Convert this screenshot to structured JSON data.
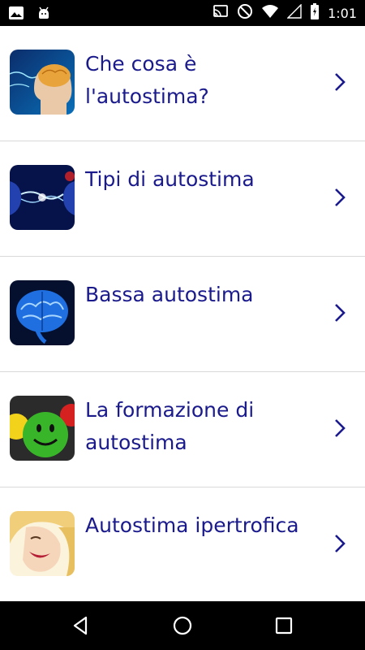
{
  "status_bar": {
    "time": "1:01",
    "left_icons": [
      "image-icon",
      "android-debug-icon"
    ],
    "right_icons": [
      "cast-icon",
      "do-not-disturb-icon",
      "wifi-icon",
      "no-signal-icon",
      "battery-charging-icon"
    ]
  },
  "list": {
    "items": [
      {
        "label": "Che cosa è l'autostima?",
        "icon": "brain-head-icon"
      },
      {
        "label": "Tipi di autostima",
        "icon": "two-faces-icon"
      },
      {
        "label": "Bassa autostima",
        "icon": "blue-brain-icon"
      },
      {
        "label": "La formazione di autostima",
        "icon": "smiley-balls-icon"
      },
      {
        "label": "Autostima ipertrofica",
        "icon": "laughing-woman-icon"
      }
    ]
  },
  "colors": {
    "label_text": "#1a1a8c",
    "chevron": "#1a1a8c",
    "divider": "#d9d9d9",
    "bars": "#000000"
  },
  "nav_bar": {
    "buttons": [
      "back-icon",
      "home-icon",
      "recents-icon"
    ]
  }
}
